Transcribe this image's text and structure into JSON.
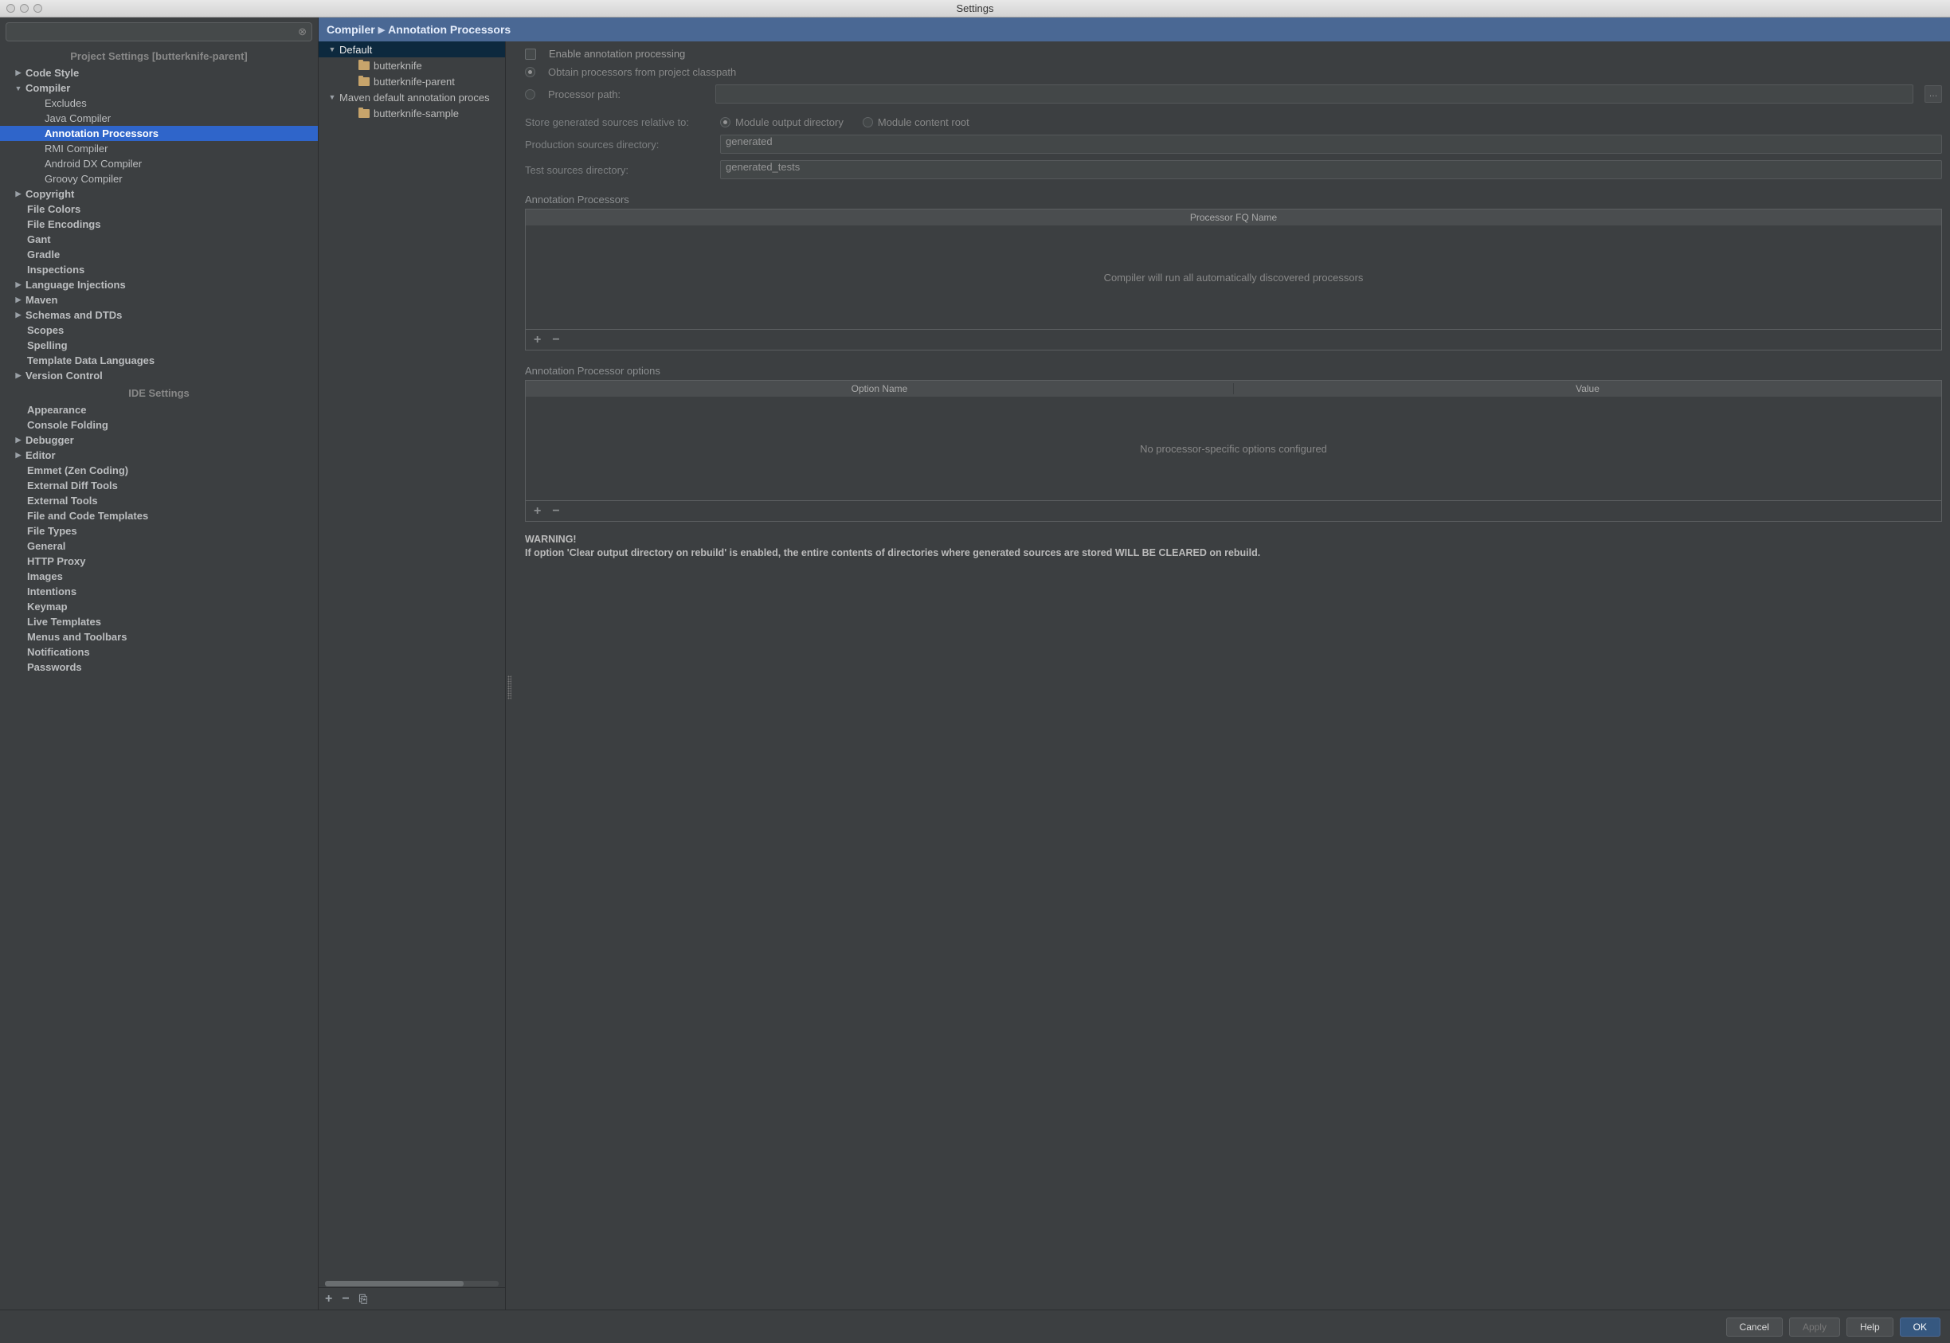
{
  "window": {
    "title": "Settings"
  },
  "breadcrumb": {
    "root": "Compiler",
    "leaf": "Annotation Processors"
  },
  "left_tree": {
    "section1_title": "Project Settings [butterknife-parent]",
    "section2_title": "IDE Settings",
    "items": {
      "code_style": "Code Style",
      "compiler": "Compiler",
      "excludes": "Excludes",
      "java_compiler": "Java Compiler",
      "annotation_processors": "Annotation Processors",
      "rmi_compiler": "RMI Compiler",
      "android_dx_compiler": "Android DX Compiler",
      "groovy_compiler": "Groovy Compiler",
      "copyright": "Copyright",
      "file_colors": "File Colors",
      "file_encodings": "File Encodings",
      "gant": "Gant",
      "gradle": "Gradle",
      "inspections": "Inspections",
      "language_injections": "Language Injections",
      "maven": "Maven",
      "schemas_dtds": "Schemas and DTDs",
      "scopes": "Scopes",
      "spelling": "Spelling",
      "template_data_languages": "Template Data Languages",
      "version_control": "Version Control",
      "appearance": "Appearance",
      "console_folding": "Console Folding",
      "debugger": "Debugger",
      "editor": "Editor",
      "emmet": "Emmet (Zen Coding)",
      "external_diff_tools": "External Diff Tools",
      "external_tools": "External Tools",
      "file_code_templates": "File and Code Templates",
      "file_types": "File Types",
      "general": "General",
      "http_proxy": "HTTP Proxy",
      "images": "Images",
      "intentions": "Intentions",
      "keymap": "Keymap",
      "live_templates": "Live Templates",
      "menus_toolbars": "Menus and Toolbars",
      "notifications": "Notifications",
      "passwords": "Passwords"
    }
  },
  "mid_tree": {
    "default": "Default",
    "butterknife": "butterknife",
    "butterknife_parent": "butterknife-parent",
    "maven_default": "Maven default annotation proces",
    "butterknife_sample": "butterknife-sample"
  },
  "form": {
    "enable_label": "Enable annotation processing",
    "obtain_label": "Obtain processors from project classpath",
    "processor_path_label": "Processor path:",
    "processor_path_value": "",
    "store_label": "Store generated sources relative to:",
    "module_output_dir": "Module output directory",
    "module_content_root": "Module content root",
    "prod_sources_label": "Production sources directory:",
    "prod_sources_value": "generated",
    "test_sources_label": "Test sources directory:",
    "test_sources_value": "generated_tests",
    "ap_section": "Annotation Processors",
    "ap_col1": "Processor FQ Name",
    "ap_empty": "Compiler will run all automatically discovered processors",
    "opt_section": "Annotation Processor options",
    "opt_col1": "Option Name",
    "opt_col2": "Value",
    "opt_empty": "No processor-specific options configured",
    "warning_head": "WARNING!",
    "warning_body": "If option 'Clear output directory on rebuild' is enabled, the entire contents of directories where generated sources are stored WILL BE CLEARED on rebuild."
  },
  "footer": {
    "cancel": "Cancel",
    "apply": "Apply",
    "help": "Help",
    "ok": "OK"
  }
}
